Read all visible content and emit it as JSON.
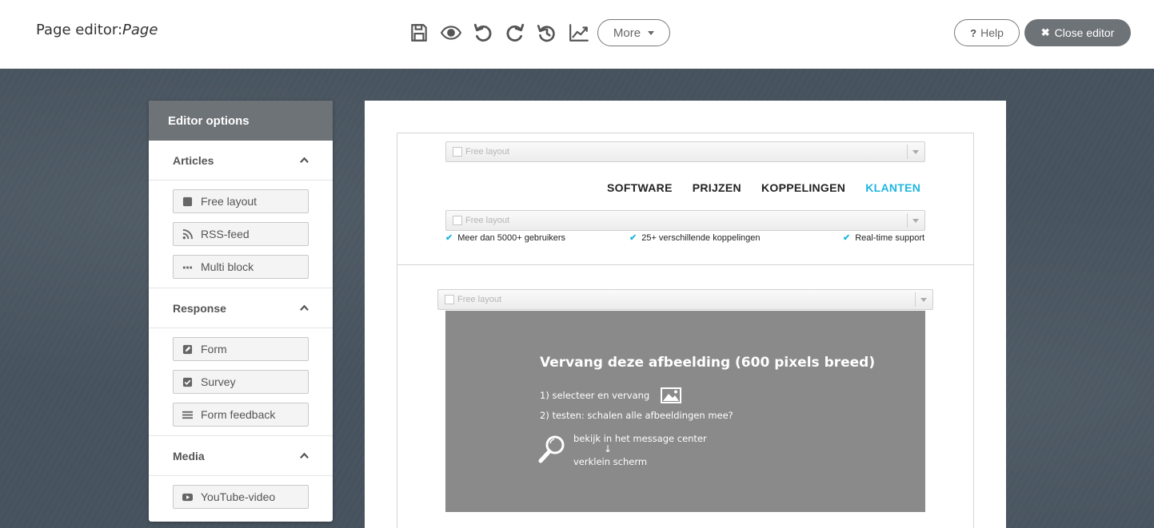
{
  "header": {
    "title": "Page editor:",
    "title_page": "Page",
    "tools": [
      "save-icon",
      "preview-eye-icon",
      "undo-icon",
      "redo-icon",
      "history-icon",
      "statistics-chart-icon"
    ],
    "more_label": "More",
    "help_label": "Help",
    "close_label": "Close editor"
  },
  "sidebar": {
    "title": "Editor options",
    "sections": [
      {
        "label": "Articles",
        "items": [
          {
            "label": "Free layout",
            "icon": "square-icon"
          },
          {
            "label": "RSS-feed",
            "icon": "rss-icon"
          },
          {
            "label": "Multi block",
            "icon": "ellipsis-icon"
          }
        ]
      },
      {
        "label": "Response",
        "items": [
          {
            "label": "Form",
            "icon": "edit-icon"
          },
          {
            "label": "Survey",
            "icon": "checkbox-icon"
          },
          {
            "label": "Form feedback",
            "icon": "list-icon"
          }
        ]
      },
      {
        "label": "Media",
        "items": [
          {
            "label": "YouTube-video",
            "icon": "youtube-icon"
          }
        ]
      }
    ]
  },
  "canvas": {
    "free_layout_label": "Free layout",
    "nav": [
      "SOFTWARE",
      "PRIJZEN",
      "KOPPELINGEN",
      "KLANTEN"
    ],
    "nav_active_color": "#1fb6e0",
    "usps": [
      "Meer dan 5000+ gebruikers",
      "25+ verschillende koppelingen",
      "Real-time support"
    ],
    "placeholder": {
      "title": "Vervang deze afbeelding  (600 pixels breed)",
      "line1": "1) selecteer en vervang",
      "line2": "2) testen: schalen alle afbeeldingen mee?",
      "line3": "bekijk in het message center",
      "arrow": "↓",
      "line4": "verklein scherm"
    }
  }
}
